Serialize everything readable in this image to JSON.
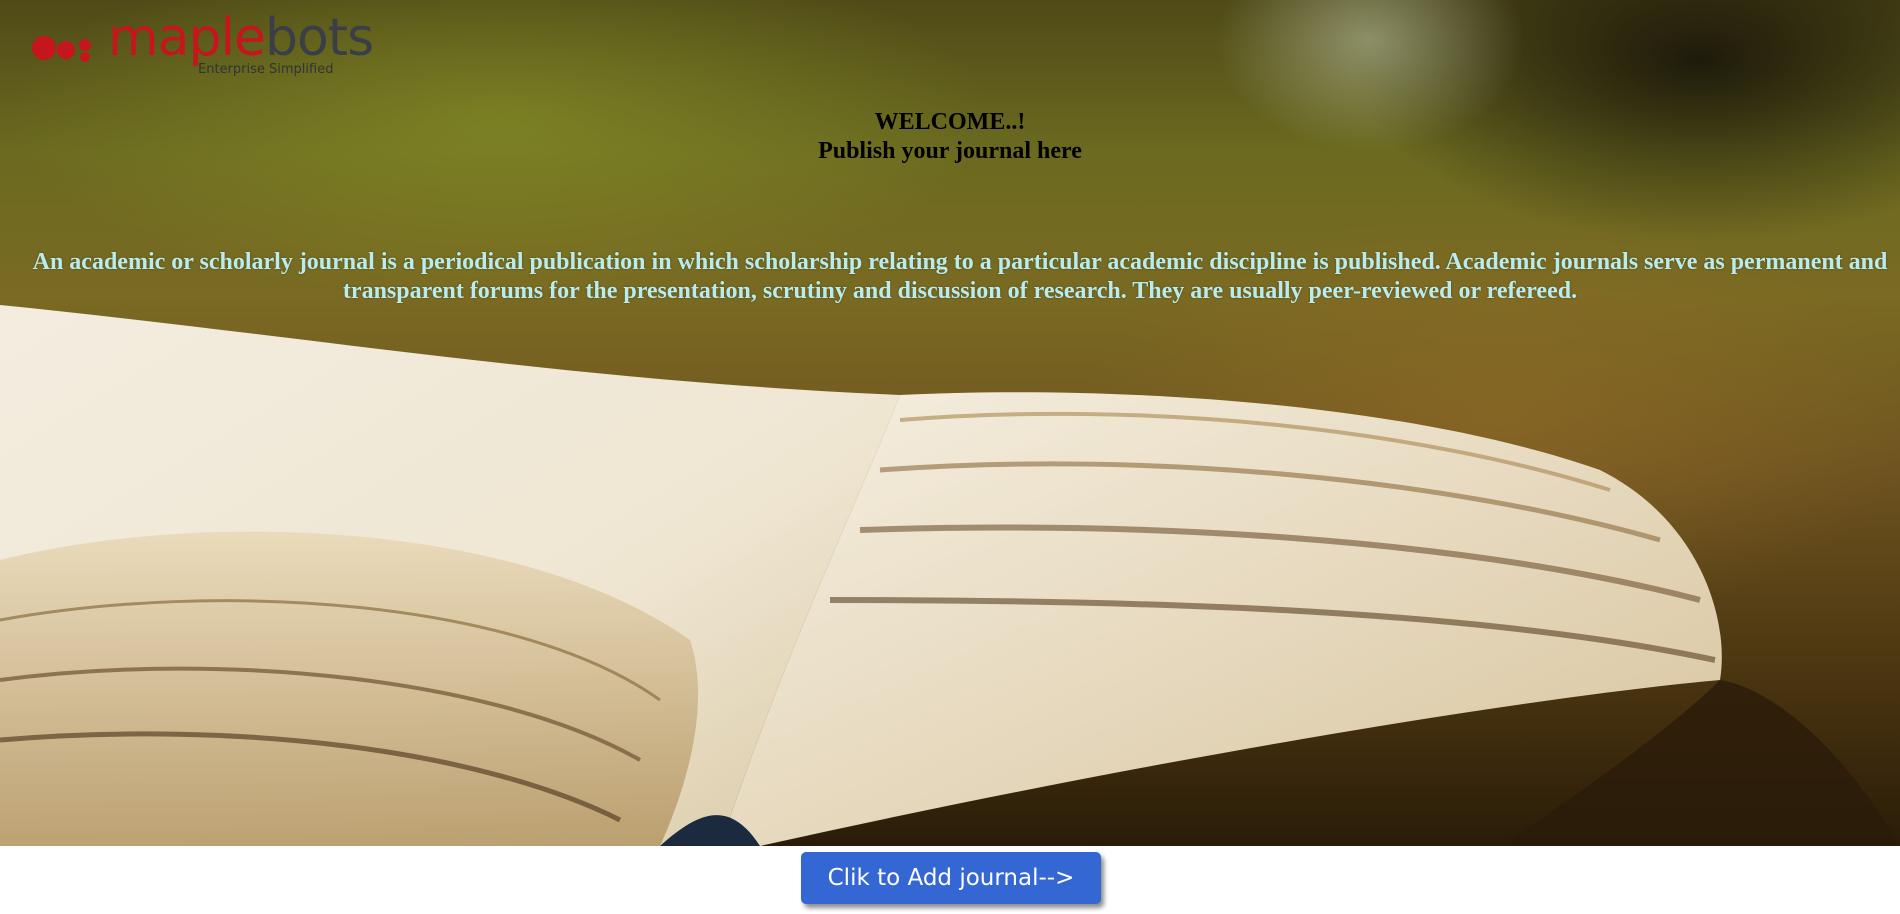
{
  "logo": {
    "brand_part1": "maple",
    "brand_part2": "bots",
    "tagline": "Enterprise Simplified",
    "brand_color": "#c4161c",
    "secondary_color": "#3a3f47"
  },
  "hero": {
    "welcome_line": "WELCOME..!",
    "subtitle_line": "Publish your journal here",
    "description": "An academic or scholarly journal is a periodical publication in which scholarship relating to a particular academic discipline is published. Academic journals serve as permanent and transparent forums for the presentation, scrutiny and discussion of research. They are usually peer-reviewed or refereed.",
    "description_color": "#b9ecec",
    "background_image": "open-book-on-grass"
  },
  "actions": {
    "add_journal_label": "Clik to Add journal-->",
    "button_color": "#3466d4"
  }
}
